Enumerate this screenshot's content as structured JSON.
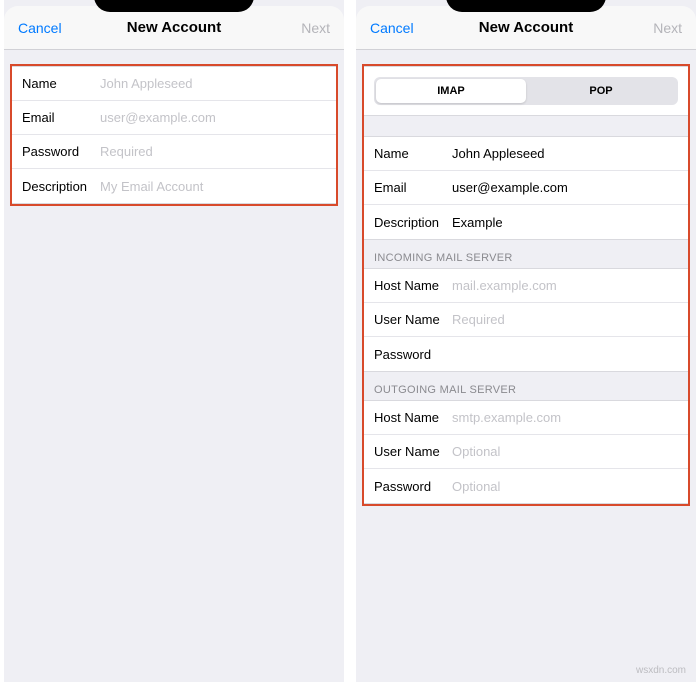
{
  "watermark": "wsxdn.com",
  "left": {
    "nav": {
      "cancel": "Cancel",
      "title": "New Account",
      "next": "Next"
    },
    "fields": {
      "name_label": "Name",
      "name_ph": "John Appleseed",
      "email_label": "Email",
      "email_ph": "user@example.com",
      "password_label": "Password",
      "password_ph": "Required",
      "desc_label": "Description",
      "desc_ph": "My Email Account"
    }
  },
  "right": {
    "nav": {
      "cancel": "Cancel",
      "title": "New Account",
      "next": "Next"
    },
    "segmented": {
      "imap": "IMAP",
      "pop": "POP"
    },
    "account": {
      "name_label": "Name",
      "name_val": "John Appleseed",
      "email_label": "Email",
      "email_val": "user@example.com",
      "desc_label": "Description",
      "desc_val": "Example"
    },
    "incoming": {
      "header": "Incoming Mail Server",
      "host_label": "Host Name",
      "host_ph": "mail.example.com",
      "user_label": "User Name",
      "user_ph": "Required",
      "pass_label": "Password",
      "pass_ph": ""
    },
    "outgoing": {
      "header": "Outgoing Mail Server",
      "host_label": "Host Name",
      "host_ph": "smtp.example.com",
      "user_label": "User Name",
      "user_ph": "Optional",
      "pass_label": "Password",
      "pass_ph": "Optional"
    }
  }
}
